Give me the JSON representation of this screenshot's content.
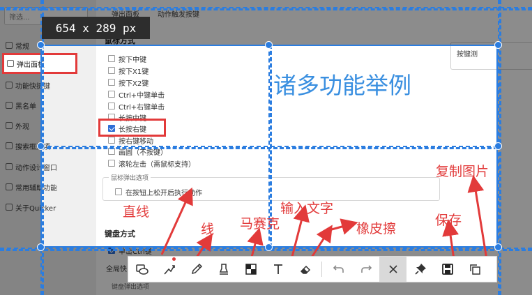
{
  "app": {
    "search_placeholder": "筛选...",
    "tabs": [
      "弹出面板",
      "动作触发按键"
    ],
    "sidebar": [
      {
        "label": "常规"
      },
      {
        "label": "弹出面板"
      },
      {
        "label": "功能快捷键"
      },
      {
        "label": "黑名单"
      },
      {
        "label": "外观"
      },
      {
        "label": "搜索框选项"
      },
      {
        "label": "动作设计窗口"
      },
      {
        "label": "常用辅助功能"
      },
      {
        "label": "关于Quicker"
      }
    ],
    "mouse_section_title": "鼠标方式",
    "mouse_options": [
      {
        "label": "按下中键",
        "checked": false
      },
      {
        "label": "按下X1键",
        "checked": false
      },
      {
        "label": "按下X2键",
        "checked": false
      },
      {
        "label": "Ctrl+中键单击",
        "checked": false
      },
      {
        "label": "Ctrl+右键单击",
        "checked": false
      },
      {
        "label": "长按中键",
        "checked": false
      },
      {
        "label": "长按右键",
        "checked": true
      },
      {
        "label": "按右键移动",
        "checked": false
      },
      {
        "label": "画圆（不按键）",
        "checked": false
      },
      {
        "label": "滚轮左击（需鼠标支持）",
        "checked": false
      }
    ],
    "popup_group_legend": "鼠标弹出选项",
    "popup_group_option": "在按钮上松开后执行动作",
    "keyboard_section_title": "键盘方式",
    "keyboard_option": "单击Ctrl键",
    "fullscreen_label": "全局快",
    "keyboard_group_legend": "键盘弹出选项",
    "right_box_label": "按键测"
  },
  "selection": {
    "size_label": "654  x  289  px"
  },
  "hero_text": "诸多功能举例",
  "annotations": {
    "line": "直线",
    "pen": "线",
    "mosaic": "马赛克",
    "text": "输入文字",
    "eraser": "橡皮擦",
    "save": "保存",
    "copy": "复制图片"
  },
  "toolbar": {
    "tools": [
      {
        "name": "shape-tool",
        "icon": "rectangle-ellipse-icon"
      },
      {
        "name": "line-tool",
        "icon": "arrow-line-icon"
      },
      {
        "name": "pen-tool",
        "icon": "pencil-icon"
      },
      {
        "name": "highlighter-tool",
        "icon": "highlighter-icon"
      },
      {
        "name": "mosaic-tool",
        "icon": "mosaic-icon"
      },
      {
        "name": "text-tool",
        "icon": "text-icon"
      },
      {
        "name": "eraser-tool",
        "icon": "eraser-icon"
      },
      {
        "name": "undo-button",
        "icon": "undo-icon"
      },
      {
        "name": "redo-button",
        "icon": "redo-icon"
      },
      {
        "name": "close-button",
        "icon": "close-icon"
      },
      {
        "name": "pin-button",
        "icon": "pin-icon"
      },
      {
        "name": "save-button",
        "icon": "save-icon"
      },
      {
        "name": "copy-button",
        "icon": "copy-icon"
      }
    ]
  },
  "colors": {
    "accent": "#2b7de0",
    "annotation": "#e23a3a",
    "hero": "#3a8fe0"
  }
}
